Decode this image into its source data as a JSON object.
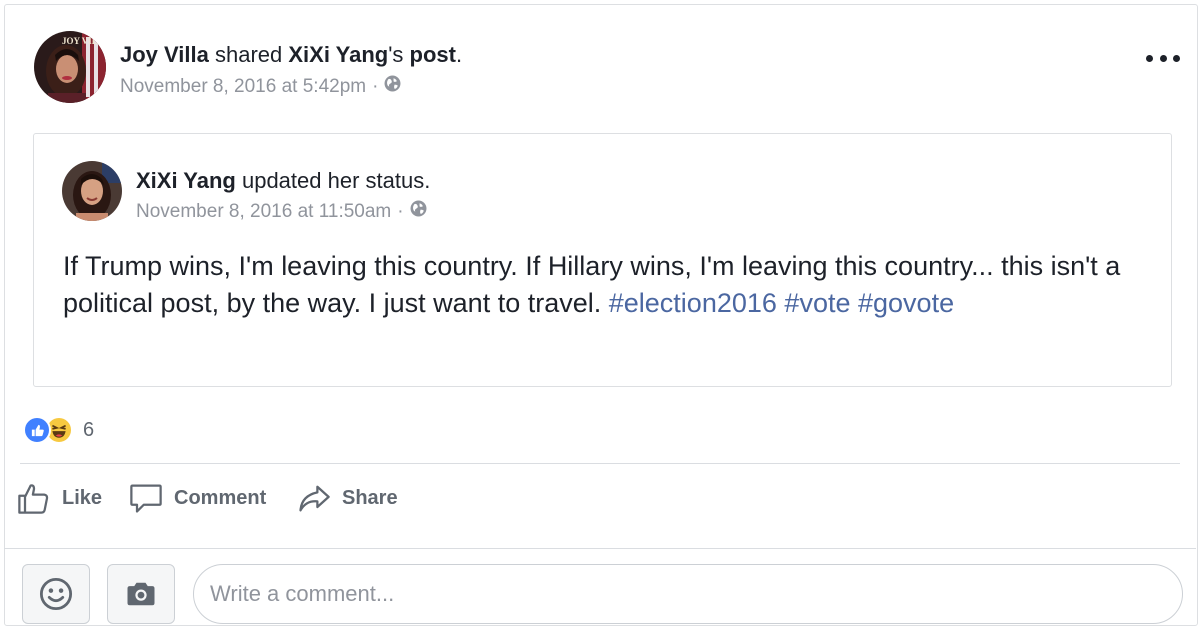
{
  "post": {
    "author_name": "Joy Villa",
    "action_text": " shared ",
    "shared_from": "XiXi Yang",
    "shared_suffix": "'s ",
    "object": "post",
    "period": ".",
    "avatar_text": "JOY VILLA",
    "timestamp": "November 8, 2016 at 5:42pm",
    "separator": "·",
    "audience_icon": "globe-icon",
    "menu_icon": "more-options-icon"
  },
  "shared_post": {
    "author_name": "XiXi Yang",
    "action_text": " updated her status.",
    "timestamp": "November 8, 2016 at 11:50am",
    "separator": "·",
    "audience_icon": "globe-icon",
    "text": "If Trump wins, I'm leaving this country. If Hillary wins, I'm leaving this country... this isn't a political post, by the way. I just want to travel. ",
    "hashtags": [
      "#election2016",
      "#vote",
      "#govote"
    ]
  },
  "reactions": {
    "icons": [
      "like-reaction-icon",
      "haha-reaction-icon"
    ],
    "count": "6"
  },
  "actions": {
    "like_label": "Like",
    "comment_label": "Comment",
    "share_label": "Share"
  },
  "composer": {
    "placeholder": "Write a comment...",
    "emoji_icon": "smiley-icon",
    "camera_icon": "camera-icon"
  },
  "colors": {
    "link": "#4b67a1",
    "meta": "#90949c",
    "like_blue": "#4080ff",
    "haha_yellow": "#f7c940"
  }
}
